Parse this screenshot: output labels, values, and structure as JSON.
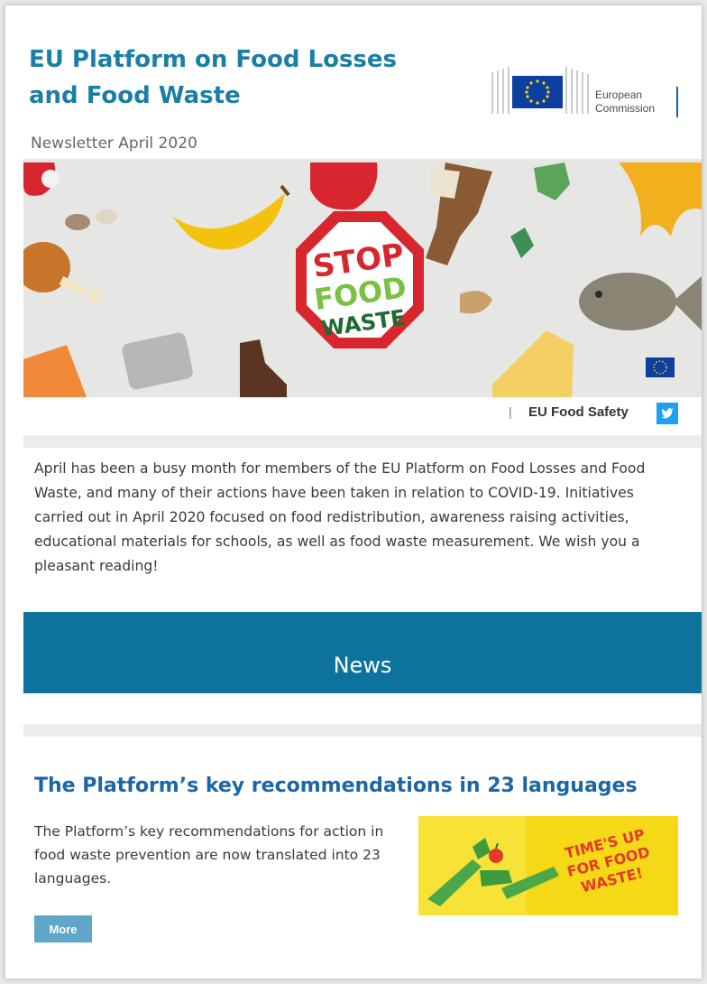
{
  "header": {
    "title": "EU Platform on Food Losses and Food Waste",
    "subtitle": "Newsletter April 2020",
    "logo_line1": "European",
    "logo_line2": "Commission"
  },
  "hero": {
    "sign_line1": "STOP",
    "sign_line2": "FOOD",
    "sign_line3": "WASTE"
  },
  "social": {
    "separator": "|",
    "label": "EU Food Safety",
    "icon": "twitter-icon"
  },
  "intro": {
    "text": "April has been a busy month for members of the EU Platform on Food Losses and Food Waste, and many of their actions have been taken in relation to COVID-19. Initiatives carried out in April 2020 focused on food redistribution, awareness raising activities, educational materials for schools, as well as food waste measurement. We wish you a pleasant reading!"
  },
  "news": {
    "heading": "News"
  },
  "article": {
    "title": "The Platform’s key recommendations in 23 languages",
    "body": "The Platform’s key recommendations for action in food waste prevention are now translated into 23 languages.",
    "image_line1": "TIME'S UP",
    "image_line2": "FOR FOOD",
    "image_line3": "WASTE!",
    "more_label": "More"
  },
  "colors": {
    "brand": "#1a7fa6",
    "banner": "#0e739c",
    "button": "#5ea7c8",
    "sign_red": "#d8262e",
    "sign_green": "#7ac142"
  }
}
